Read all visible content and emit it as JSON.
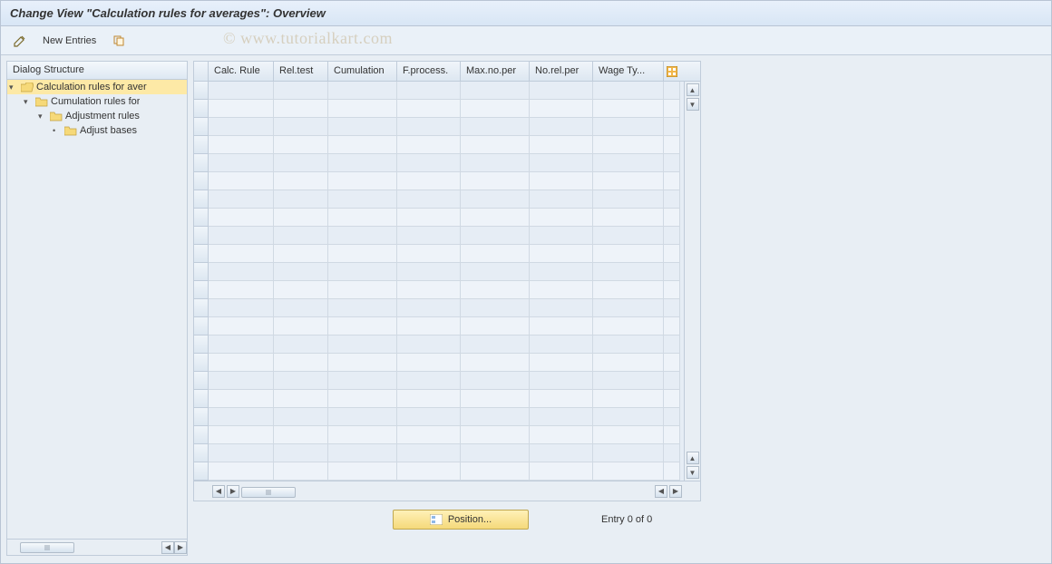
{
  "title": "Change View \"Calculation rules for averages\": Overview",
  "watermark": "© www.tutorialkart.com",
  "toolbar": {
    "new_entries": "New Entries"
  },
  "dialog_structure": {
    "header": "Dialog Structure",
    "items": [
      {
        "label": "Calculation rules for aver",
        "level": 0,
        "open": true,
        "selected": true
      },
      {
        "label": "Cumulation rules for",
        "level": 1,
        "open": true,
        "selected": false
      },
      {
        "label": "Adjustment rules",
        "level": 2,
        "open": true,
        "selected": false
      },
      {
        "label": "Adjust bases",
        "level": 3,
        "open": false,
        "selected": false
      }
    ]
  },
  "grid": {
    "columns": [
      "Calc. Rule",
      "Rel.test",
      "Cumulation",
      "F.process.",
      "Max.no.per",
      "No.rel.per",
      "Wage Ty..."
    ],
    "row_count": 22
  },
  "footer": {
    "position_button": "Position...",
    "entry_text": "Entry 0 of 0"
  }
}
